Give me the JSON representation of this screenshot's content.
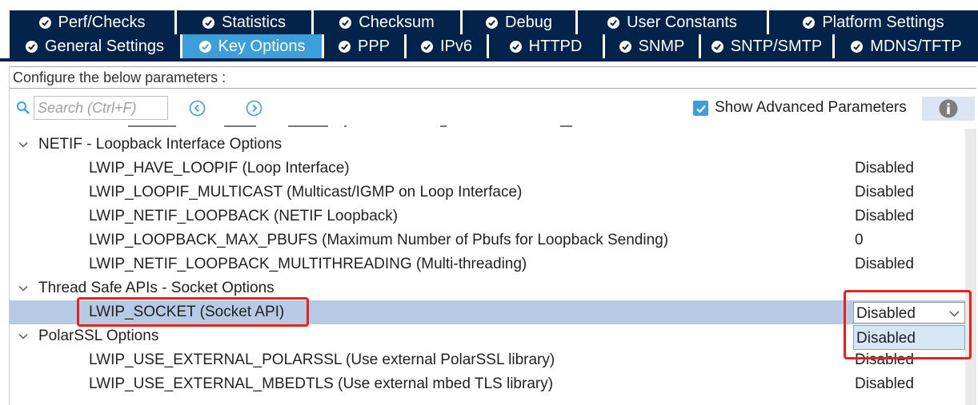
{
  "tabs_row1": [
    {
      "label": "Perf/Checks"
    },
    {
      "label": "Statistics"
    },
    {
      "label": "Checksum"
    },
    {
      "label": "Debug"
    },
    {
      "label": "User Constants"
    },
    {
      "label": "Platform Settings"
    }
  ],
  "tabs_row2": [
    {
      "label": "General Settings"
    },
    {
      "label": "Key Options",
      "active": true
    },
    {
      "label": "PPP"
    },
    {
      "label": "IPv6"
    },
    {
      "label": "HTTPD"
    },
    {
      "label": "SNMP"
    },
    {
      "label": "SNTP/SMTP"
    },
    {
      "label": "MDNS/TFTP"
    }
  ],
  "description": "Configure the below parameters :",
  "search": {
    "placeholder": "Search (Ctrl+F)"
  },
  "advanced": {
    "label": "Show Advanced Parameters",
    "checked": true
  },
  "groups": [
    {
      "title": "NETIF - Loopback Interface Options",
      "params": [
        {
          "name": "LWIP_HAVE_LOOPIF (Loop Interface)",
          "value": "Disabled"
        },
        {
          "name": "LWIP_LOOPIF_MULTICAST (Multicast/IGMP on Loop Interface)",
          "value": "Disabled"
        },
        {
          "name": "LWIP_NETIF_LOOPBACK (NETIF Loopback)",
          "value": "Disabled"
        },
        {
          "name": "LWIP_LOOPBACK_MAX_PBUFS (Maximum Number of Pbufs for Loopback Sending)",
          "value": "0"
        },
        {
          "name": "LWIP_NETIF_LOOPBACK_MULTITHREADING (Multi-threading)",
          "value": "Disabled"
        }
      ]
    },
    {
      "title": "Thread Safe APIs - Socket Options",
      "params": [
        {
          "name": "LWIP_SOCKET (Socket API)",
          "value": "Disabled",
          "selected": true
        }
      ]
    },
    {
      "title": "PolarSSL Options",
      "params": [
        {
          "name": "LWIP_USE_EXTERNAL_POLARSSL (Use external PolarSSL library)",
          "value": "Disabled"
        },
        {
          "name": "LWIP_USE_EXTERNAL_MBEDTLS (Use external mbed TLS library)",
          "value": "Disabled"
        }
      ]
    }
  ],
  "dropdown": {
    "selected": "Disabled",
    "options": [
      "Disabled"
    ]
  },
  "colors": {
    "tab_bg": "#03234b",
    "tab_active": "#3c9fd9",
    "selected_row": "#b6cae3",
    "highlight": "#e8211d"
  }
}
